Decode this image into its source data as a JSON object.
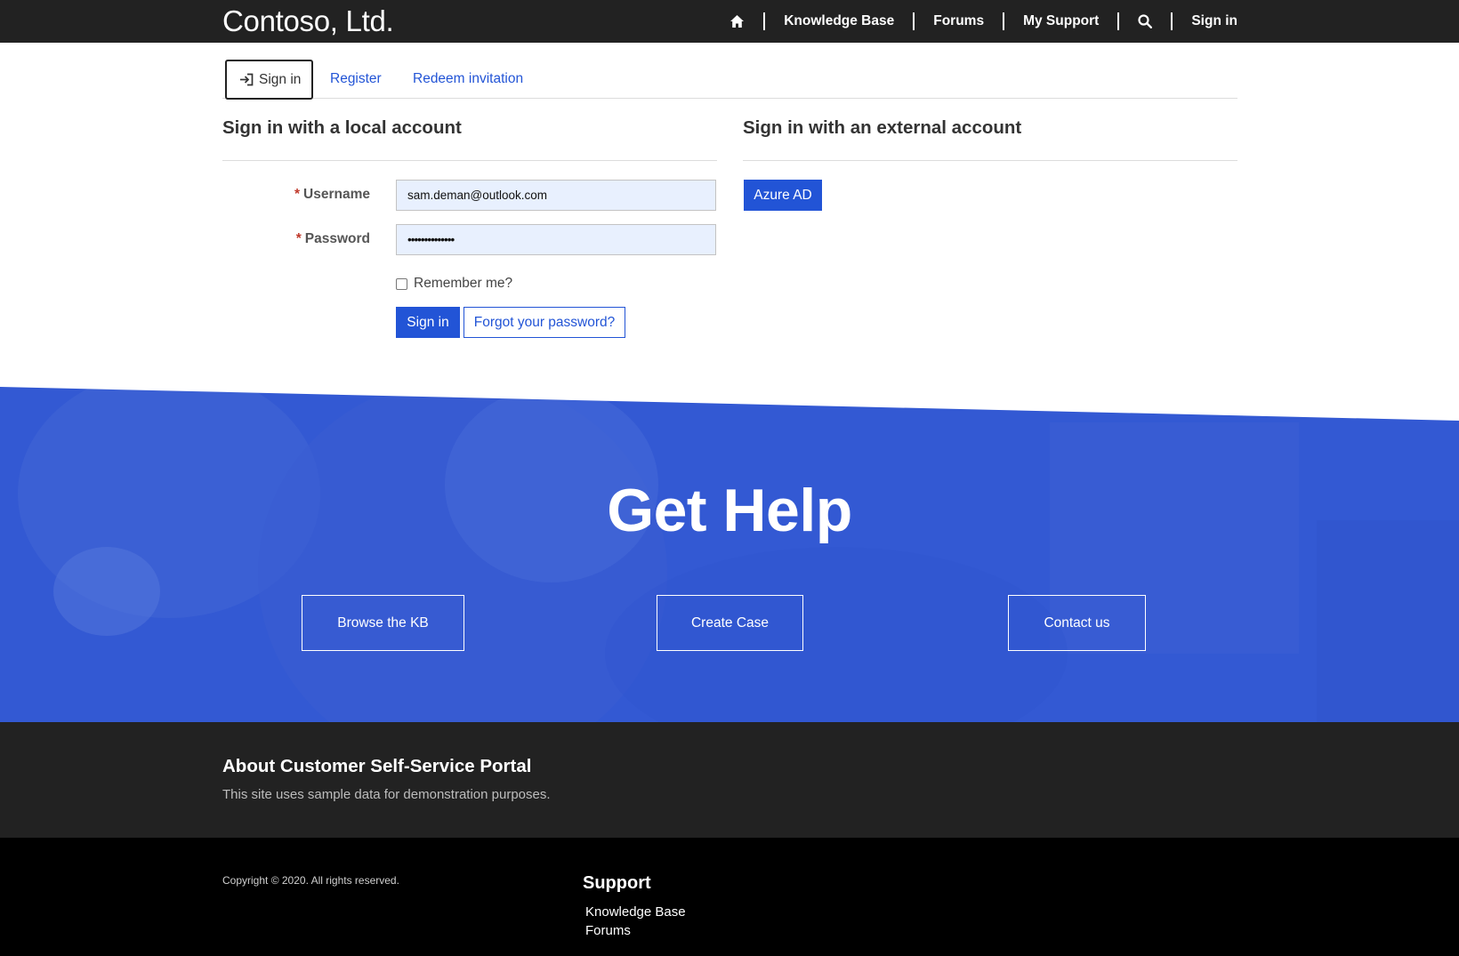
{
  "navbar": {
    "brand": "Contoso, Ltd.",
    "home_icon": "home-icon",
    "links": {
      "knowledge_base": "Knowledge Base",
      "forums": "Forums",
      "my_support": "My Support",
      "sign_in": "Sign in"
    },
    "search_icon": "search-icon"
  },
  "tabs": {
    "sign_in": "Sign in",
    "register": "Register",
    "redeem": "Redeem invitation",
    "sign_in_icon": "sign-in-icon"
  },
  "local": {
    "title": "Sign in with a local account",
    "username_label": "Username",
    "username_value": "sam.deman@outlook.com",
    "password_label": "Password",
    "password_value": "••••••••••••••",
    "required_mark": "*",
    "remember_label": "Remember me?",
    "remember_checked": false,
    "sign_in_button": "Sign in",
    "forgot_button": "Forgot your password?"
  },
  "external": {
    "title": "Sign in with an external account",
    "azure_button": "Azure AD"
  },
  "hero": {
    "title": "Get Help",
    "browse_kb": "Browse the KB",
    "create_case": "Create Case",
    "contact_us": "Contact us"
  },
  "about": {
    "title": "About Customer Self-Service Portal",
    "text": "This site uses sample data for demonstration purposes."
  },
  "footer": {
    "copyright": "Copyright © 2020. All rights reserved.",
    "support_heading": "Support",
    "links": {
      "knowledge_base": "Knowledge Base",
      "forums": "Forums"
    }
  },
  "colors": {
    "accent": "#2254d6",
    "hero": "#3359d3",
    "nav_bg": "#222222",
    "footer_bg": "#000000"
  }
}
